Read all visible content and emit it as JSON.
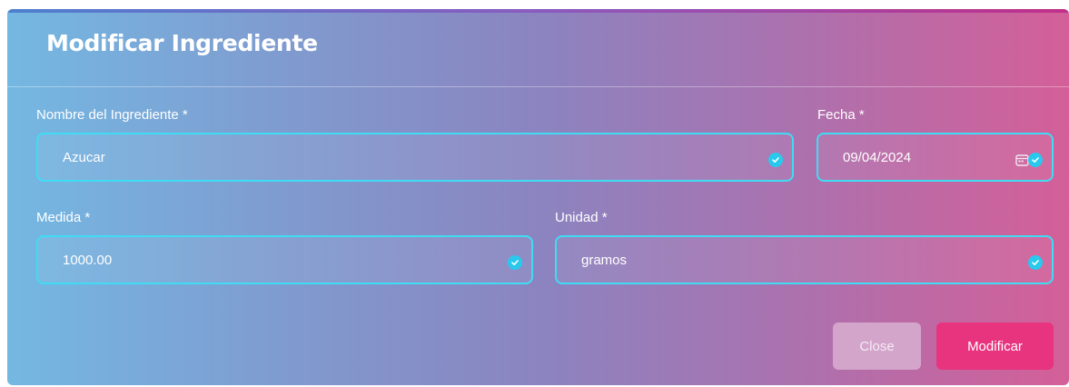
{
  "modal": {
    "title": "Modificar Ingrediente"
  },
  "form": {
    "nombre": {
      "label": "Nombre del Ingrediente *",
      "value": "Azucar"
    },
    "fecha": {
      "label": "Fecha *",
      "value": "09/04/2024"
    },
    "medida": {
      "label": "Medida *",
      "value": "1000.00"
    },
    "unidad": {
      "label": "Unidad *",
      "value": "gramos"
    }
  },
  "actions": {
    "close_label": "Close",
    "submit_label": "Modificar"
  },
  "colors": {
    "field_border": "#3fdcf3",
    "check": "#29c9ee",
    "submit": "#e8337e",
    "close": "#d3a5cb"
  }
}
